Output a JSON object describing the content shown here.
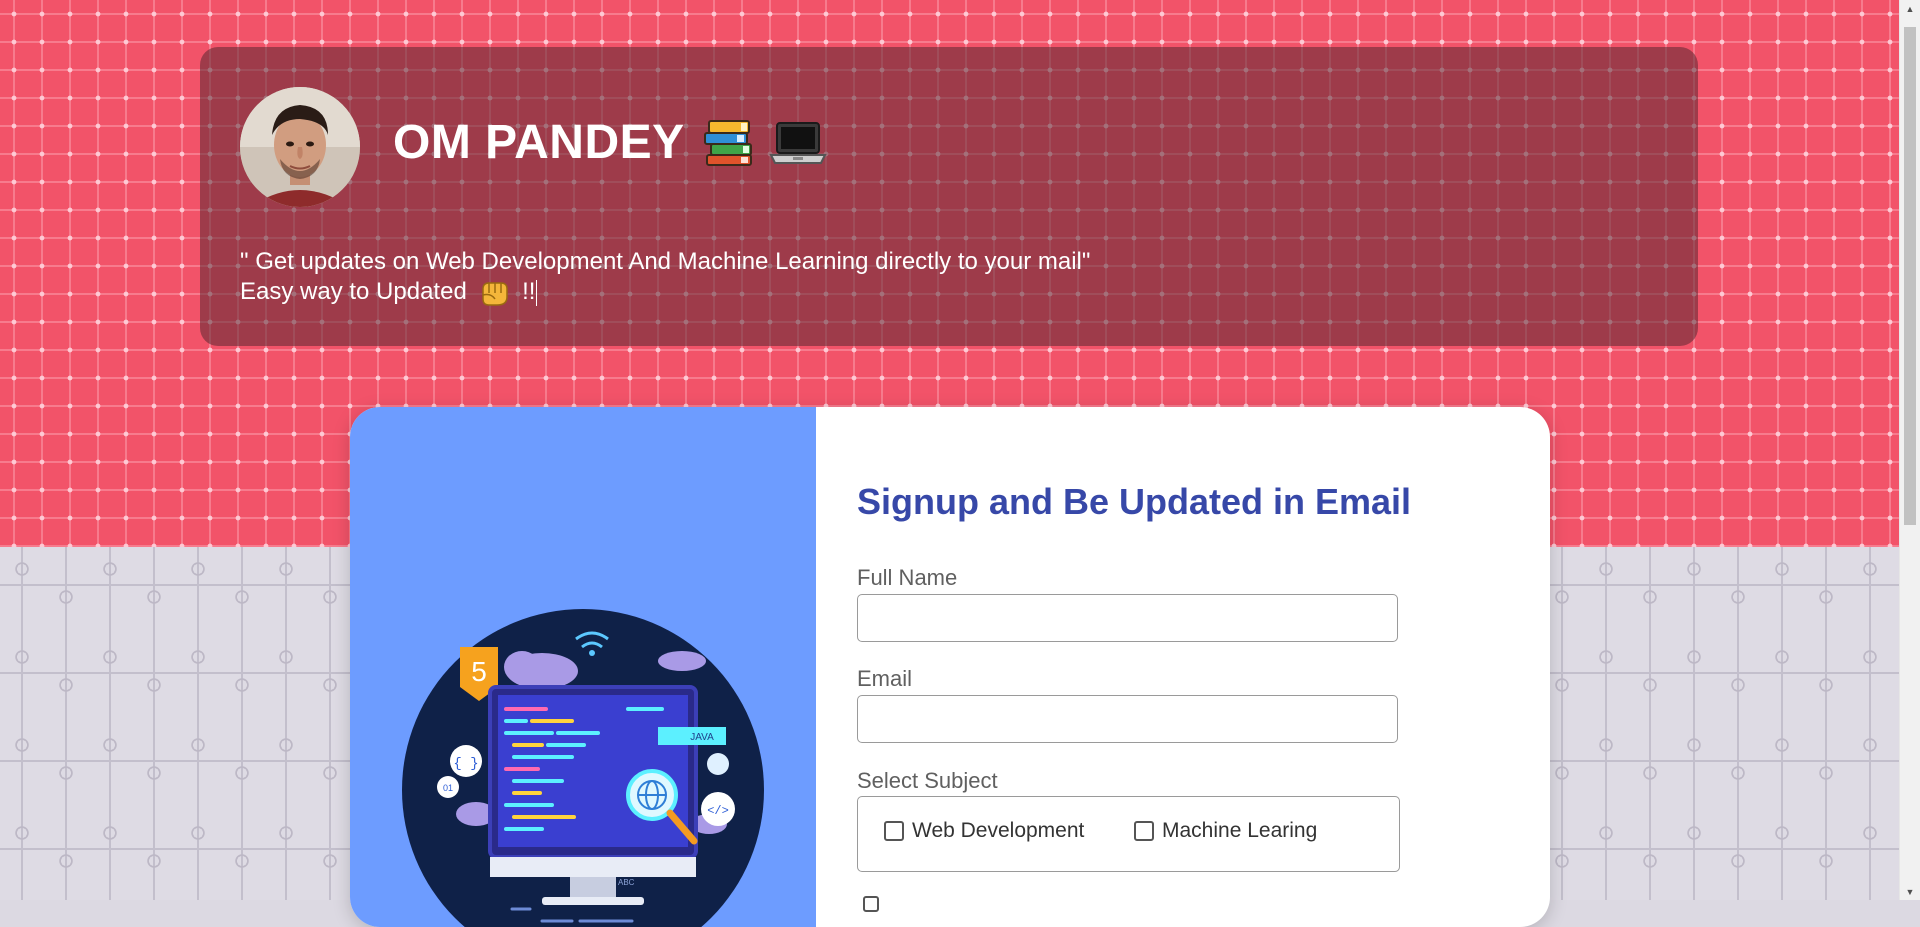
{
  "header": {
    "name": "OM PANDEY",
    "name_emojis": [
      "📚",
      "💻"
    ],
    "tagline_line1": "\" Get updates on Web Development And Machine Learning directly to your mail\"",
    "tagline_line2": "Easy way to Updated",
    "tagline_emoji": "👊",
    "tagline_suffix": "!!"
  },
  "signup": {
    "title": "Signup and Be Updated in Email",
    "fields": {
      "full_name_label": "Full Name",
      "full_name_value": "",
      "email_label": "Email",
      "email_value": ""
    },
    "subject": {
      "label": "Select Subject",
      "options": [
        "Web Development",
        "Machine Learing"
      ]
    },
    "illustration": {
      "badge_text": "5",
      "java_label": "JAVA",
      "abc_label": "ABC",
      "braces": "{ }",
      "code_tag": "</>",
      "zero_one": "01"
    }
  },
  "colors": {
    "top_background": "#f25369",
    "header_card": "#5a2832",
    "left_panel": "#6d9cff",
    "title_color": "#3748a8"
  }
}
